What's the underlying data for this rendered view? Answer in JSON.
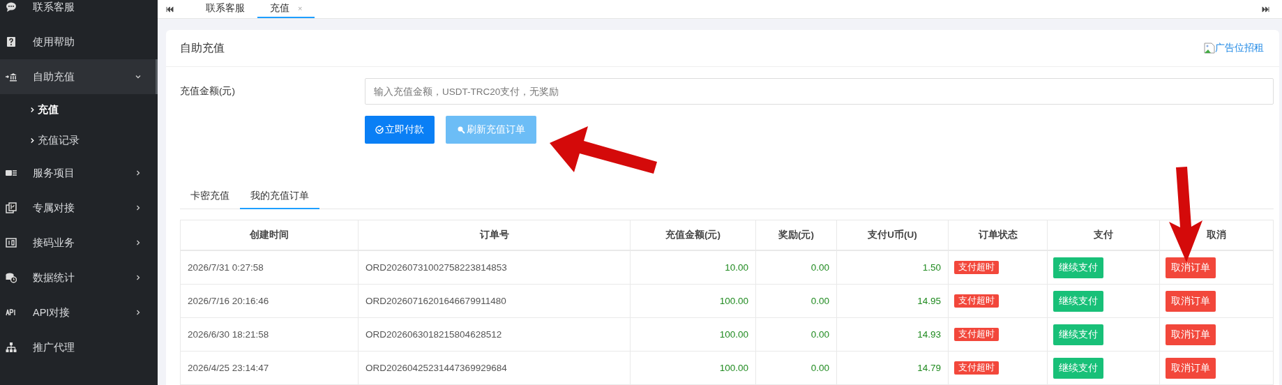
{
  "sidebar": {
    "items": [
      {
        "label": "联系客服",
        "expandable": false,
        "selected": false
      },
      {
        "label": "使用帮助",
        "expandable": false,
        "selected": false
      },
      {
        "label": "自助充值",
        "expandable": true,
        "expanded": true,
        "selected": true,
        "children": [
          {
            "label": "充值",
            "selected": true
          },
          {
            "label": "充值记录",
            "selected": false
          }
        ]
      },
      {
        "label": "服务项目",
        "expandable": true,
        "expanded": false,
        "selected": false
      },
      {
        "label": "专属对接",
        "expandable": true,
        "expanded": false,
        "selected": false
      },
      {
        "label": "接码业务",
        "expandable": true,
        "expanded": false,
        "selected": false
      },
      {
        "label": "数据统计",
        "expandable": true,
        "expanded": false,
        "selected": false
      },
      {
        "label": "API对接",
        "expandable": true,
        "expanded": false,
        "selected": false
      },
      {
        "label": "推广代理",
        "expandable": false,
        "selected": false
      }
    ]
  },
  "tabs": [
    {
      "label": "联系客服",
      "selected": false
    },
    {
      "label": "充值",
      "selected": true,
      "close": "×"
    }
  ],
  "card": {
    "title": "自助充值",
    "ad_link": "广告位招租",
    "form": {
      "label": "充值金额(元)",
      "placeholder": "输入充值金额，USDT-TRC20支付，无奖励"
    },
    "buttons": [
      {
        "label": "立即付款",
        "kind": "primary"
      },
      {
        "label": "刷新充值订单",
        "kind": "refresh"
      }
    ],
    "inner_tabs": [
      {
        "label": "卡密充值",
        "selected": false
      },
      {
        "label": "我的充值订单",
        "selected": true
      }
    ],
    "table": {
      "columns": [
        "创建时间",
        "订单号",
        "充值金额(元)",
        "奖励(元)",
        "支付U币(U)",
        "订单状态",
        "支付",
        "取消"
      ],
      "rows": [
        {
          "time": "2026/7/31 0:27:58",
          "order": "ORD20260731002758223814853",
          "amount": "10.00",
          "bonus": "0.00",
          "usdt": "1.50",
          "status": "支付超时",
          "pay": "继续支付",
          "cancel": "取消订单"
        },
        {
          "time": "2026/7/16 20:16:46",
          "order": "ORD20260716201646679911480",
          "amount": "100.00",
          "bonus": "0.00",
          "usdt": "14.95",
          "status": "支付超时",
          "pay": "继续支付",
          "cancel": "取消订单"
        },
        {
          "time": "2026/6/30 18:21:58",
          "order": "ORD2026063018215804628512",
          "amount": "100.00",
          "bonus": "0.00",
          "usdt": "14.93",
          "status": "支付超时",
          "pay": "继续支付",
          "cancel": "取消订单"
        },
        {
          "time": "2026/4/25 23:14:47",
          "order": "ORD20260425231447369929684",
          "amount": "100.00",
          "bonus": "0.00",
          "usdt": "14.79",
          "status": "支付超时",
          "pay": "继续支付",
          "cancel": "取消订单"
        }
      ]
    }
  }
}
